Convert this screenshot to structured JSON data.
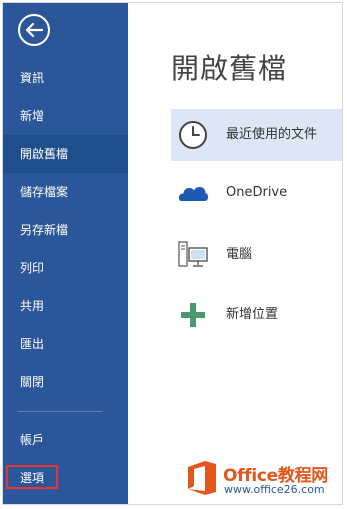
{
  "sidebar": {
    "back_icon": "back-arrow-icon",
    "items": [
      {
        "label": "資訊"
      },
      {
        "label": "新增"
      },
      {
        "label": "開啟舊檔"
      },
      {
        "label": "儲存檔案"
      },
      {
        "label": "另存新檔"
      },
      {
        "label": "列印"
      },
      {
        "label": "共用"
      },
      {
        "label": "匯出"
      },
      {
        "label": "關閉"
      }
    ],
    "bottom_items": [
      {
        "label": "帳戶"
      },
      {
        "label": "選項"
      }
    ],
    "active_index": 2,
    "colors": {
      "background": "#2b579a",
      "active": "#1e4e8c",
      "highlight_box": "#e8332e"
    }
  },
  "main": {
    "title": "開啟舊檔",
    "locations": [
      {
        "label": "最近使用的文件",
        "icon": "clock-icon",
        "selected": true
      },
      {
        "label": "OneDrive",
        "icon": "cloud-icon",
        "selected": false
      },
      {
        "label": "電腦",
        "icon": "computer-icon",
        "selected": false
      },
      {
        "label": "新增位置",
        "icon": "plus-icon",
        "selected": false
      }
    ]
  },
  "watermark": {
    "brand": "Office教程网",
    "url": "www.office26.com",
    "icon": "office-logo-icon"
  }
}
